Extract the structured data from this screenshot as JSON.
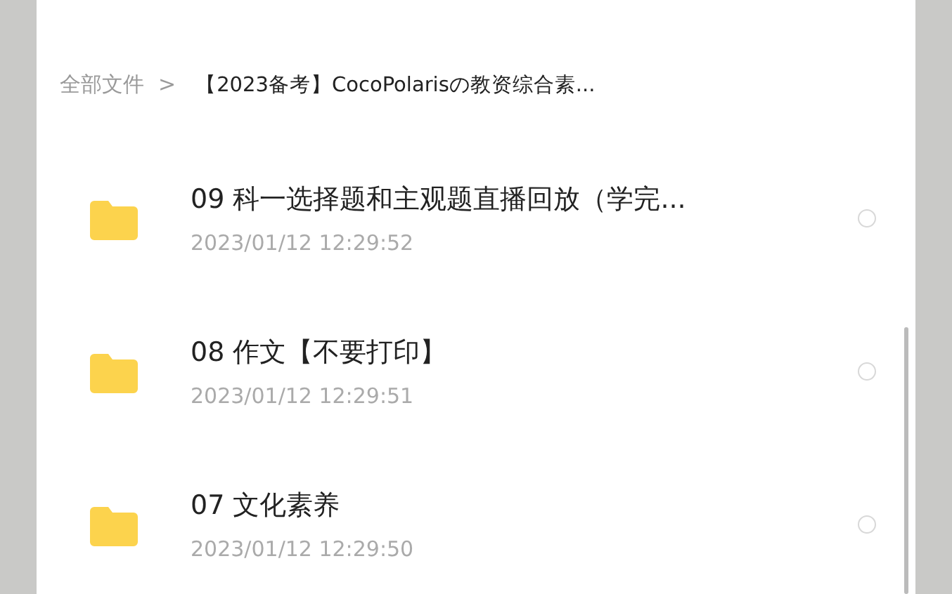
{
  "breadcrumb": {
    "root": "全部文件",
    "separator": ">",
    "current": "【2023备考】CocoPolarisの教资综合素..."
  },
  "files": [
    {
      "name": "09 科一选择题和主观题直播回放（学完...",
      "date": "2023/01/12 12:29:52",
      "selected": false
    },
    {
      "name": "08 作文【不要打印】",
      "date": "2023/01/12 12:29:51",
      "selected": false
    },
    {
      "name": "07 文化素养",
      "date": "2023/01/12 12:29:50",
      "selected": false
    }
  ]
}
